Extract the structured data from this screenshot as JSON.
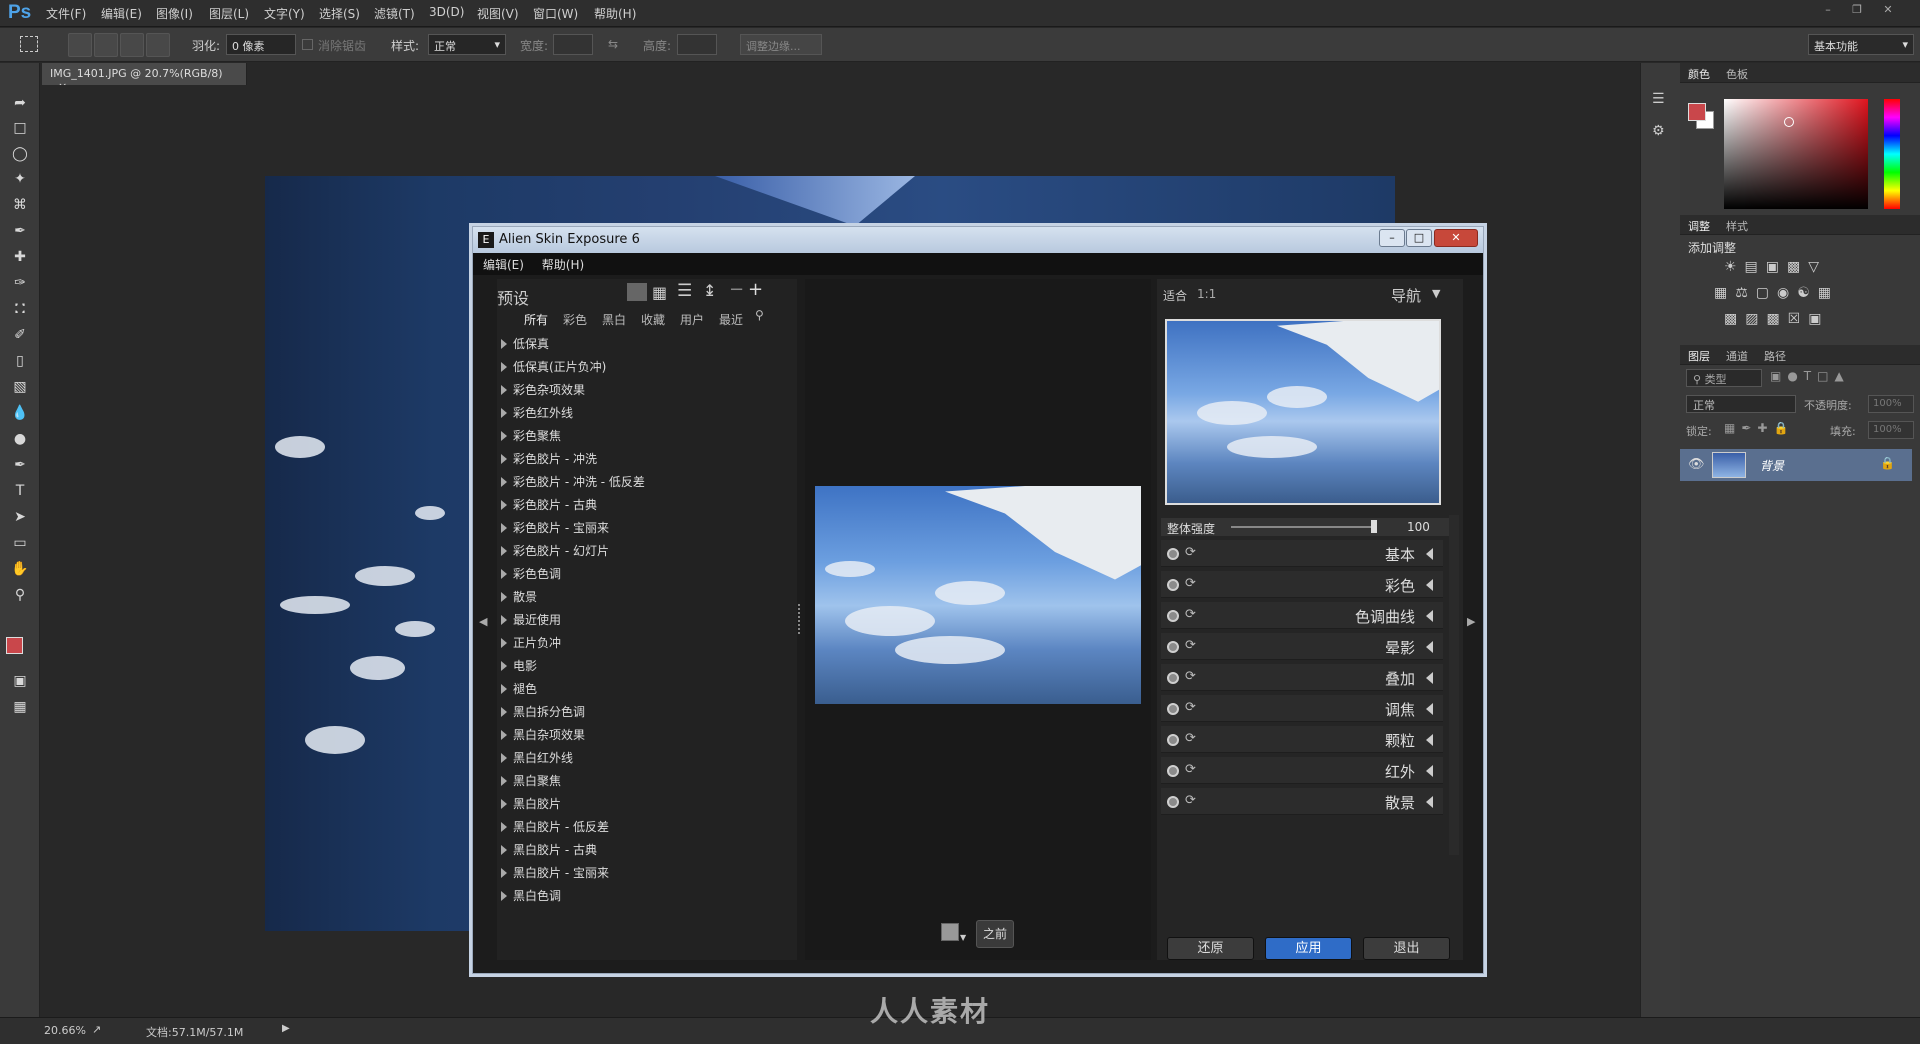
{
  "app": {
    "logo": "Ps",
    "workspace": "基本功能"
  },
  "menu": [
    "文件(F)",
    "编辑(E)",
    "图像(I)",
    "图层(L)",
    "文字(Y)",
    "选择(S)",
    "滤镜(T)",
    "3D(D)",
    "视图(V)",
    "窗口(W)",
    "帮助(H)"
  ],
  "options": {
    "feather_label": "羽化:",
    "feather_value": "0 像素",
    "antialias_label": "消除锯齿",
    "style_label": "样式:",
    "style_value": "正常",
    "width_label": "宽度:",
    "height_label": "高度:",
    "refine_button": "调整边缘..."
  },
  "document": {
    "tab": "IMG_1401.JPG @ 20.7%(RGB/8)",
    "zoom": "20.66%",
    "docsize": "文档:57.1M/57.1M"
  },
  "panels": {
    "color_tabs": [
      "颜色",
      "色板"
    ],
    "adjust_tabs": [
      "调整",
      "样式"
    ],
    "adjust_title": "添加调整",
    "layers_tabs": [
      "图层",
      "通道",
      "路径"
    ],
    "filter_kind": "类型",
    "blend_mode": "正常",
    "opacity_label": "不透明度:",
    "opacity_value": "100%",
    "lock_label": "锁定:",
    "fill_label": "填充:",
    "fill_value": "100%",
    "layer_name": "背景"
  },
  "dialog": {
    "title": "Alien Skin Exposure 6",
    "menu": [
      "编辑(E)",
      "帮助(H)"
    ],
    "presets_title": "预设",
    "filters": [
      "所有",
      "彩色",
      "黑白",
      "收藏",
      "用户",
      "最近"
    ],
    "presets": [
      "低保真",
      "低保真(正片负冲)",
      "彩色杂项效果",
      "彩色红外线",
      "彩色聚焦",
      "彩色胶片 - 冲洗",
      "彩色胶片 - 冲洗 - 低反差",
      "彩色胶片 - 古典",
      "彩色胶片 - 宝丽来",
      "彩色胶片 - 幻灯片",
      "彩色色调",
      "散景",
      "最近使用",
      "正片负冲",
      "电影",
      "褪色",
      "黑白拆分色调",
      "黑白杂项效果",
      "黑白红外线",
      "黑白聚焦",
      "黑白胶片",
      "黑白胶片 - 低反差",
      "黑白胶片 - 古典",
      "黑白胶片 - 宝丽来",
      "黑白色调"
    ],
    "before_button": "之前",
    "fit_label": "适合",
    "ratio_label": "1:1",
    "nav_label": "导航",
    "strength_label": "整体强度",
    "strength_value": "100",
    "adjustments": [
      "基本",
      "彩色",
      "色调曲线",
      "晕影",
      "叠加",
      "调焦",
      "颗粒",
      "红外",
      "散景"
    ],
    "buttons": {
      "reset": "还原",
      "apply": "应用",
      "exit": "退出"
    }
  },
  "watermark": "人人素材",
  "colors": {
    "fg": "#c9474b",
    "accent": "#2f6cc7"
  }
}
